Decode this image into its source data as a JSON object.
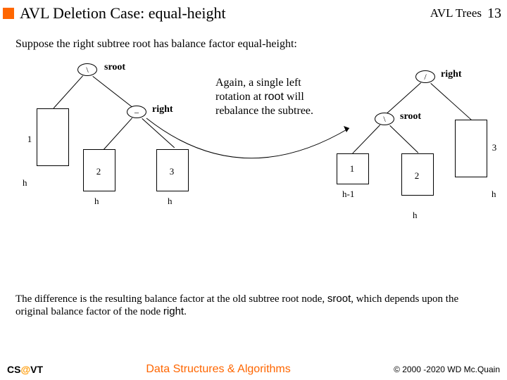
{
  "header": {
    "title": "AVL Deletion Case: equal-height",
    "course": "AVL Trees",
    "pagenum": "13"
  },
  "intro": "Suppose the right subtree root has balance factor equal-height:",
  "left_tree": {
    "sroot_label": "sroot",
    "sroot_bf": "\\",
    "right_label": "right",
    "right_bf": "–",
    "box1": "1",
    "box2": "2",
    "box3": "3",
    "h_left": "h",
    "h_mid": "h",
    "h_right": "h"
  },
  "explain": {
    "line1": "Again, a single left",
    "line2a": "rotation at ",
    "line2b": "root",
    "line2c": " will",
    "line3": "rebalance the subtree."
  },
  "right_tree": {
    "right_label": "right",
    "right_bf": "/",
    "sroot_label": "sroot",
    "sroot_bf": "\\",
    "box1": "1",
    "box2": "2",
    "box3": "3",
    "h_left": "h-1",
    "h_mid": "h",
    "h_right": "h"
  },
  "conclusion": {
    "t1": "The difference is the resulting balance factor at the old subtree root node, ",
    "sroot": "sroot",
    "t2": ", which depends upon the original balance factor of the node ",
    "right": "right",
    "t3": "."
  },
  "footer": {
    "cs1": "CS",
    "cs2": "@",
    "cs3": "VT",
    "title": "Data Structures & Algorithms",
    "copy": "© 2000 -2020 WD Mc.Quain"
  }
}
